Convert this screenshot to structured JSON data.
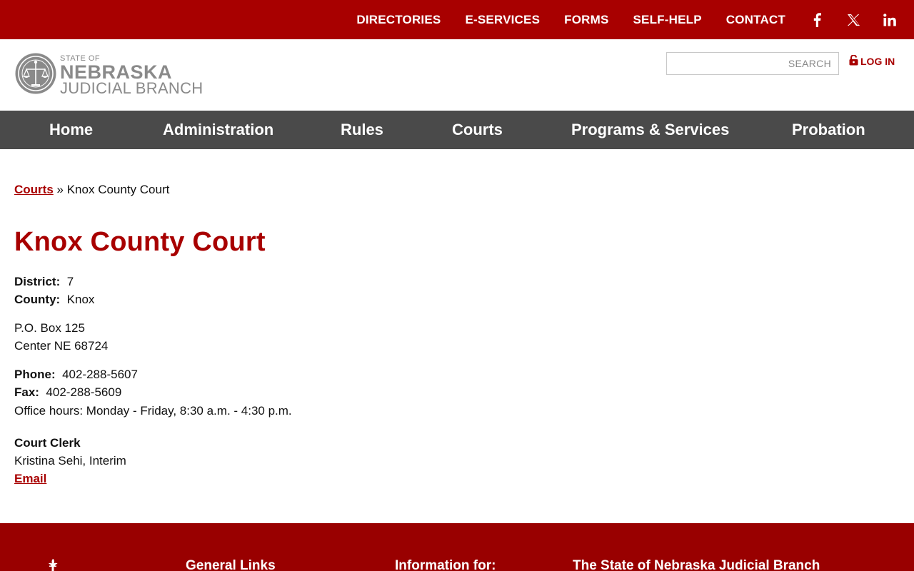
{
  "topnav": {
    "items": [
      "DIRECTORIES",
      "E-SERVICES",
      "FORMS",
      "SELF-HELP",
      "CONTACT"
    ],
    "social": [
      "facebook-icon",
      "x-icon",
      "linkedin-icon"
    ]
  },
  "header": {
    "logo": {
      "line1": "STATE OF",
      "line2": "NEBRASKA",
      "line3": "JUDICIAL BRANCH"
    },
    "search_placeholder": "SEARCH",
    "login_label": "LOG IN"
  },
  "mainnav": {
    "items": [
      "Home",
      "Administration",
      "Rules",
      "Courts",
      "Programs & Services",
      "Probation"
    ]
  },
  "breadcrumb": {
    "parent": "Courts",
    "separator": "»",
    "current": "Knox County Court"
  },
  "page": {
    "title": "Knox County Court",
    "district_label": "District:",
    "district_value": "7",
    "county_label": "County:",
    "county_value": "Knox",
    "address_line1": "P.O. Box 125",
    "address_line2": "Center NE 68724",
    "phone_label": "Phone:",
    "phone_value": "402-288-5607",
    "fax_label": "Fax:",
    "fax_value": "402-288-5609",
    "hours": "Office hours: Monday - Friday, 8:30 a.m. - 4:30 p.m.",
    "clerk_heading": "Court Clerk",
    "clerk_name": "Kristina Sehi, Interim",
    "email_label": "Email"
  },
  "footer": {
    "headings": [
      "General Links",
      "Information for:",
      "The State of Nebraska Judicial Branch"
    ]
  },
  "colors": {
    "brand_red": "#a80000",
    "nav_gray": "#4a4a4a",
    "footer_red": "#990000"
  }
}
